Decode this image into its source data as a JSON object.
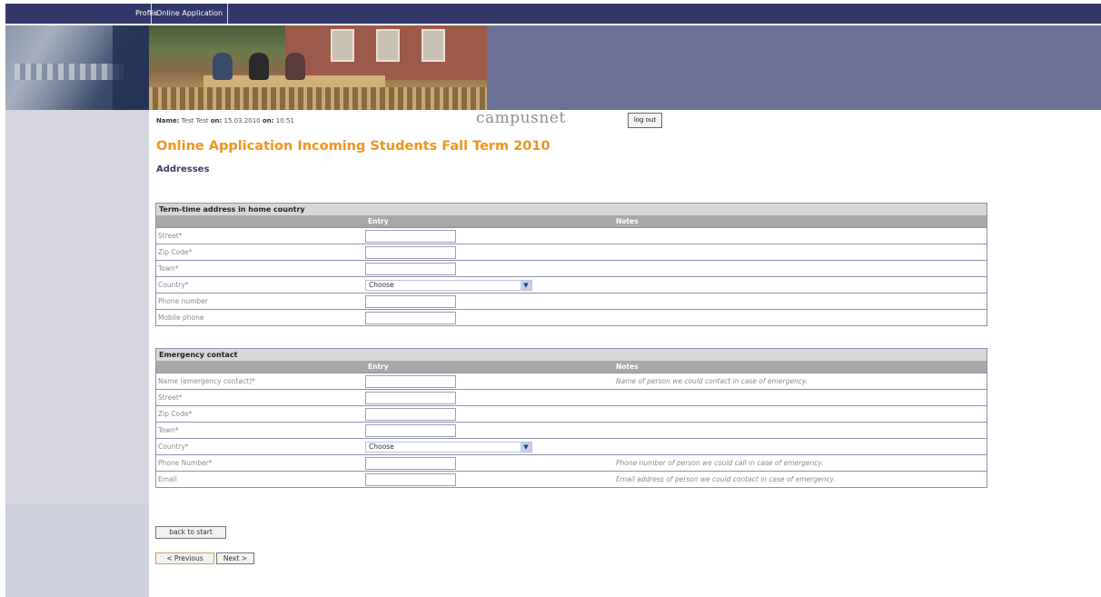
{
  "nav": {
    "profile": "Profile",
    "online_application": "Online Application"
  },
  "user": {
    "name_label": "Name:",
    "name": "Test Test",
    "on_label1": "on:",
    "date": "15.03.2010",
    "on_label2": "on:",
    "time": "10:51"
  },
  "brand": "campusnet",
  "logout": "log out",
  "page_title": "Online Application Incoming Students Fall Term 2010",
  "section_title": "Addresses",
  "term_address": {
    "title": "Term-time address in home country",
    "col_entry": "Entry",
    "col_notes": "Notes",
    "rows": [
      {
        "label": "Street*"
      },
      {
        "label": "Zip Code*"
      },
      {
        "label": "Town*"
      },
      {
        "label": "Country*",
        "select": "Choose"
      },
      {
        "label": "Phone number"
      },
      {
        "label": "Mobile phone"
      }
    ]
  },
  "emergency": {
    "title": "Emergency contact",
    "col_entry": "Entry",
    "col_notes": "Notes",
    "rows": [
      {
        "label": "Name (emergency contact)*",
        "note": "Name of person we could contact in case of emergency."
      },
      {
        "label": "Street*"
      },
      {
        "label": "Zip Code*"
      },
      {
        "label": "Town*"
      },
      {
        "label": "Country*",
        "select": "Choose"
      },
      {
        "label": "Phone Number*",
        "note": "Phone number of person we could call in case of emergency."
      },
      {
        "label": "Email",
        "note": "Email address of person we could contact in case of emergency."
      }
    ]
  },
  "buttons": {
    "back": "back to start",
    "previous": "< Previous",
    "next": "Next >"
  },
  "colors": {
    "nav_bg": "#33376a",
    "title_orange": "#f0941e",
    "section_navy": "#3a3c6c",
    "banner_right": "#6c7095"
  }
}
